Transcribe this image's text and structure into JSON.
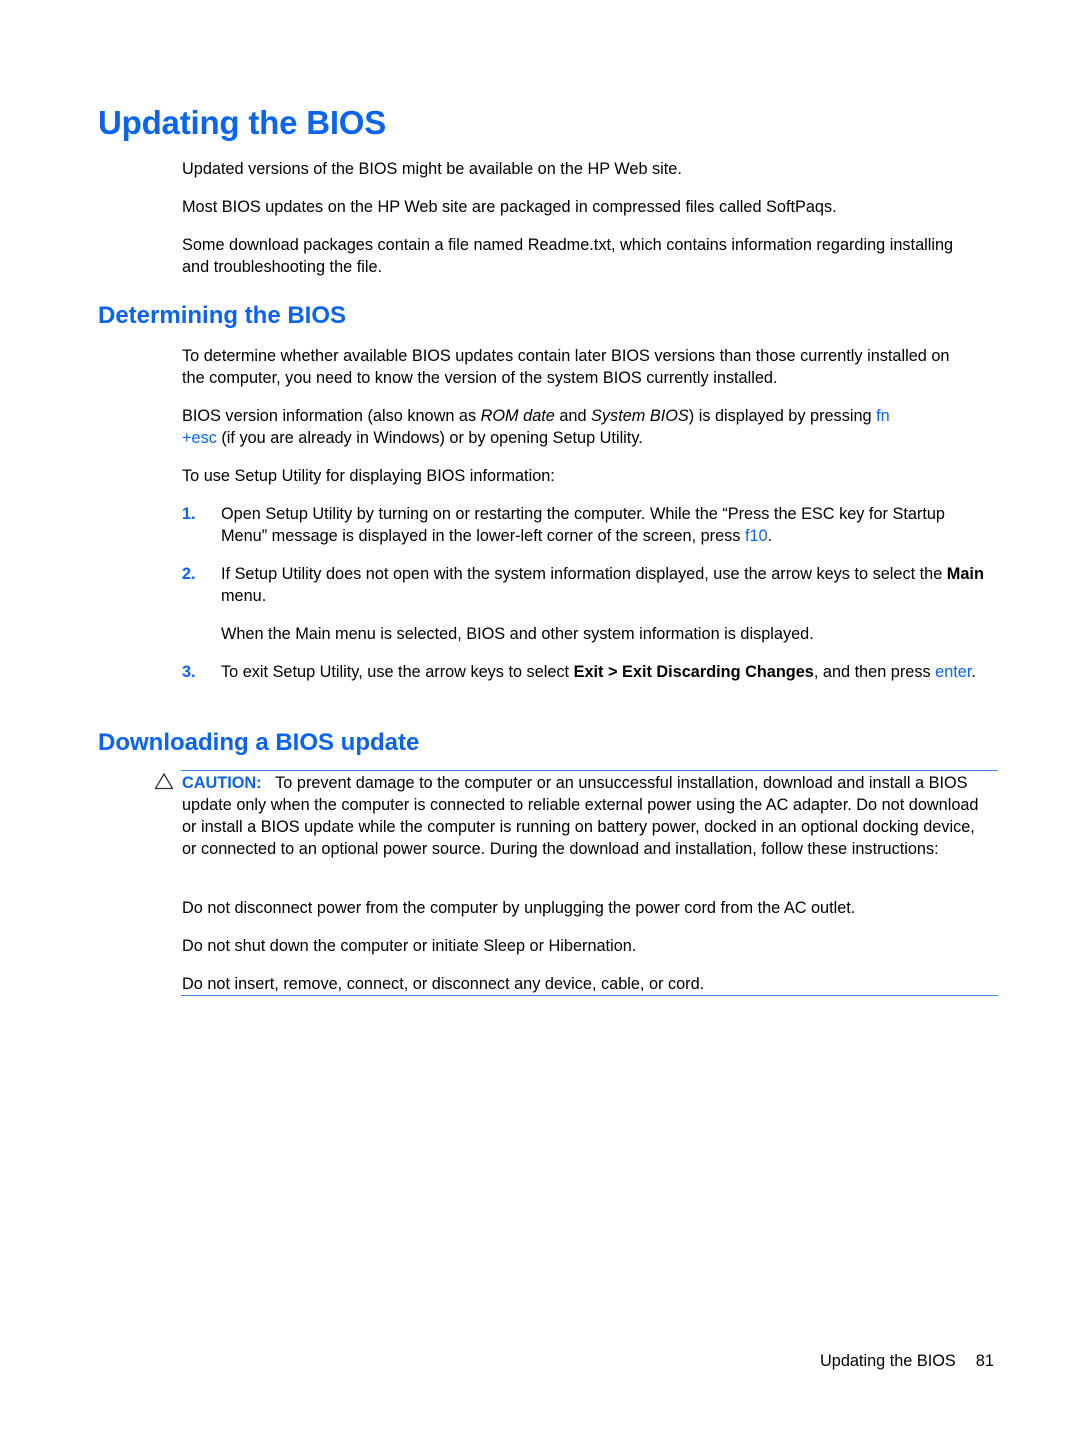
{
  "page": {
    "title": "Updating the BIOS",
    "intro": [
      "Updated versions of the BIOS might be available on the HP Web site.",
      "Most BIOS updates on the HP Web site are packaged in compressed files called SoftPaqs.",
      "Some download packages contain a file named Readme.txt, which contains information regarding installing and troubleshooting the file."
    ]
  },
  "determining": {
    "heading": "Determining the BIOS",
    "para1": "To determine whether available BIOS updates contain later BIOS versions than those currently installed on the computer, you need to know the version of the system BIOS currently installed.",
    "para2": {
      "t1": "BIOS version information (also known as ",
      "i1": "ROM date",
      "t2": " and ",
      "i2": "System BIOS",
      "t3": ") is displayed by pressing ",
      "key1": "fn",
      "key2": "+esc",
      "t4": " (if you are already in Windows) or by opening Setup Utility."
    },
    "para3": "To use Setup Utility for displaying BIOS information:",
    "steps": [
      {
        "num": "1.",
        "text": "Open Setup Utility by turning on or restarting the computer. While the “Press the ESC key for Startup Menu” message is displayed in the lower-left corner of the screen, press ",
        "key": "f10",
        "end": "."
      },
      {
        "num": "2.",
        "text": "If Setup Utility does not open with the system information displayed, use the arrow keys to select the ",
        "bold": "Main",
        "end": " menu.",
        "sub": "When the Main menu is selected, BIOS and other system information is displayed."
      },
      {
        "num": "3.",
        "text": "To exit Setup Utility, use the arrow keys to select ",
        "bold": "Exit > Exit Discarding Changes",
        "mid": ", and then press ",
        "key": "enter",
        "end": "."
      }
    ]
  },
  "downloading": {
    "heading": "Downloading a BIOS update",
    "caution": {
      "icon": "warning-triangle-icon",
      "label": "CAUTION:",
      "text": "To prevent damage to the computer or an unsuccessful installation, download and install a BIOS update only when the computer is connected to reliable external power using the AC adapter. Do not download or install a BIOS update while the computer is running on battery power, docked in an optional docking device, or connected to an optional power source. During the download and installation, follow these instructions:",
      "instructions": [
        "Do not disconnect power from the computer by unplugging the power cord from the AC outlet.",
        "Do not shut down the computer or initiate Sleep or Hibernation.",
        "Do not insert, remove, connect, or disconnect any device, cable, or cord."
      ]
    }
  },
  "footer": {
    "section": "Updating the BIOS",
    "page_number": "81"
  },
  "colors": {
    "accent": "#0a64f0",
    "rule": "#3d8af7"
  }
}
